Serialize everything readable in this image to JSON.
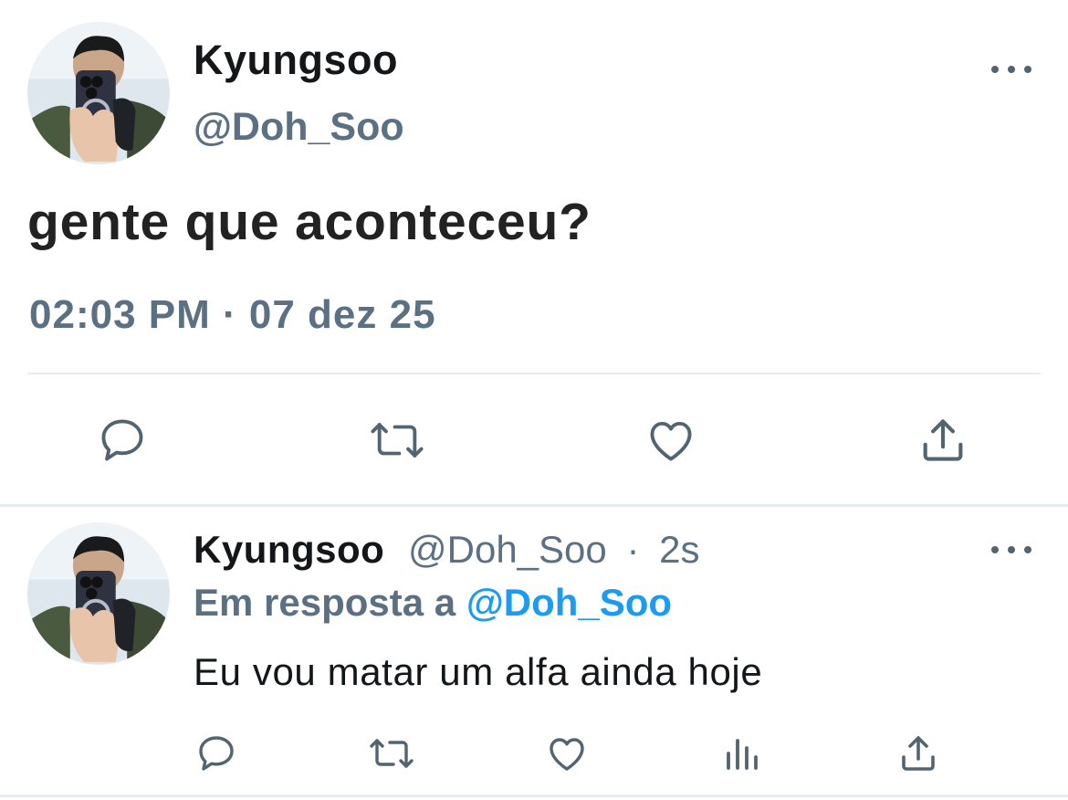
{
  "main_tweet": {
    "author": {
      "display_name": "Kyungsoo",
      "handle": "@Doh_Soo",
      "avatar": "profile-photo"
    },
    "text": "gente que aconteceu?",
    "timestamp": "02:03 PM · 07 dez 25",
    "actions": [
      "reply-icon",
      "retweet-icon",
      "like-icon",
      "share-icon"
    ],
    "more_icon": "more-horizontal-icon"
  },
  "reply_tweet": {
    "author": {
      "display_name": "Kyungsoo",
      "handle": "@Doh_Soo",
      "avatar": "profile-photo"
    },
    "separator": "·",
    "age": "2s",
    "reply_prefix": "Em resposta a",
    "reply_to": "@Doh_Soo",
    "text": "Eu vou matar um alfa ainda hoje",
    "actions": [
      "reply-icon",
      "retweet-icon",
      "like-icon",
      "analytics-icon",
      "share-icon"
    ],
    "more_icon": "more-horizontal-icon"
  },
  "colors": {
    "text_primary": "#14171a",
    "text_secondary": "#5b7083",
    "link": "#1d9bf0",
    "icon": "#536471",
    "divider": "#e6ecf0"
  }
}
